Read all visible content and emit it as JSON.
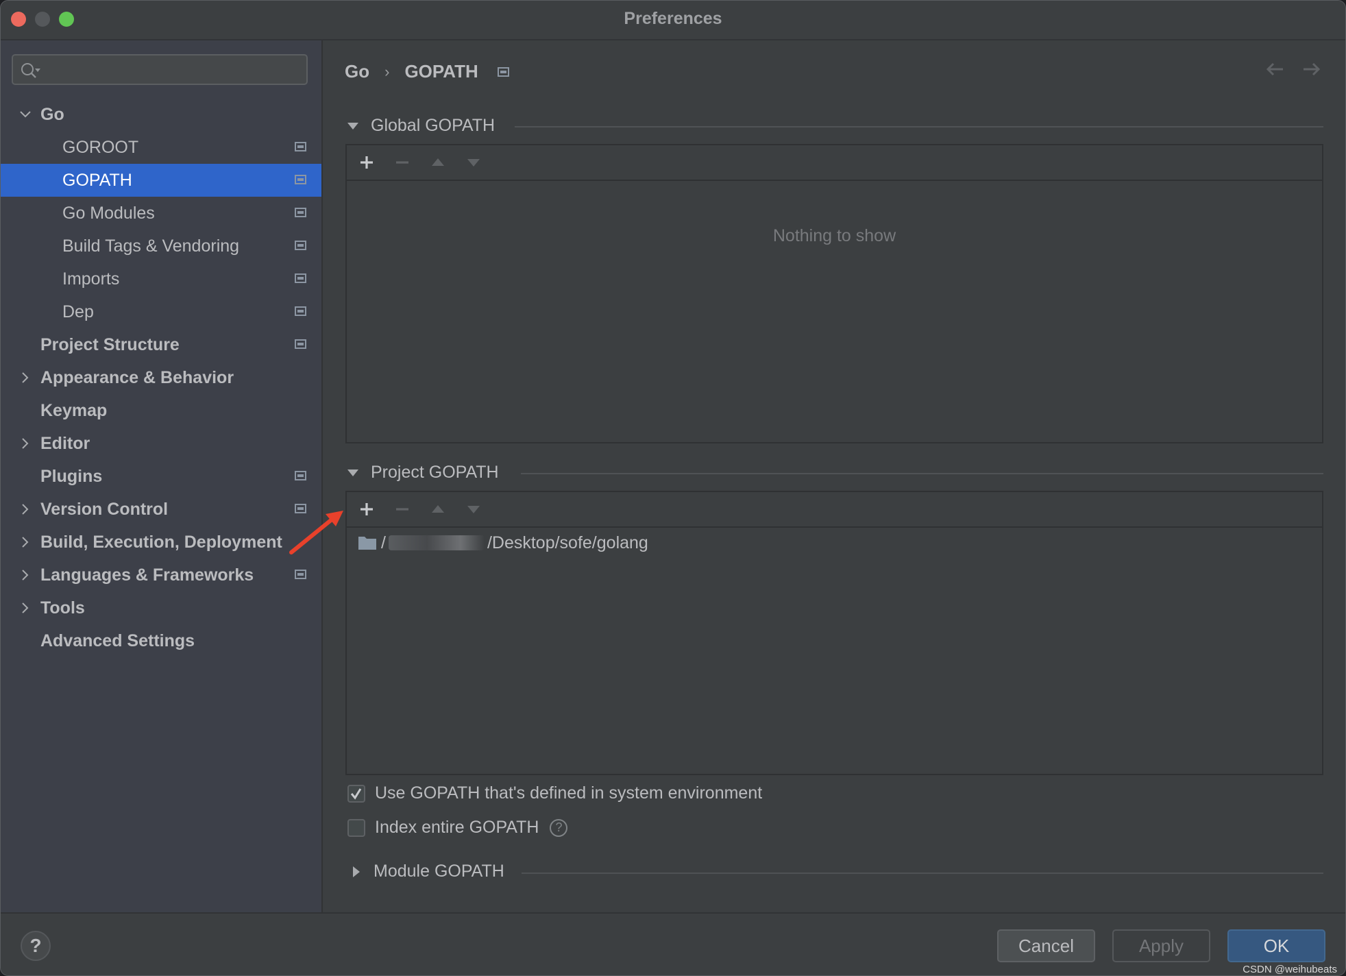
{
  "window": {
    "title": "Preferences",
    "controls": [
      "close",
      "minimize",
      "maximize"
    ]
  },
  "sidebar": {
    "search": {
      "value": "",
      "placeholder": ""
    },
    "items": [
      {
        "label": "Go",
        "level": 0,
        "expandable": true,
        "expanded": true,
        "bold": true,
        "project_icon": false,
        "selected": false
      },
      {
        "label": "GOROOT",
        "level": 1,
        "expandable": false,
        "bold": false,
        "project_icon": true,
        "selected": false
      },
      {
        "label": "GOPATH",
        "level": 1,
        "expandable": false,
        "bold": false,
        "project_icon": true,
        "selected": true
      },
      {
        "label": "Go Modules",
        "level": 1,
        "expandable": false,
        "bold": false,
        "project_icon": true,
        "selected": false
      },
      {
        "label": "Build Tags & Vendoring",
        "level": 1,
        "expandable": false,
        "bold": false,
        "project_icon": true,
        "selected": false
      },
      {
        "label": "Imports",
        "level": 1,
        "expandable": false,
        "bold": false,
        "project_icon": true,
        "selected": false
      },
      {
        "label": "Dep",
        "level": 1,
        "expandable": false,
        "bold": false,
        "project_icon": true,
        "selected": false
      },
      {
        "label": "Project Structure",
        "level": 0,
        "expandable": false,
        "bold": true,
        "project_icon": true,
        "selected": false
      },
      {
        "label": "Appearance & Behavior",
        "level": 0,
        "expandable": true,
        "expanded": false,
        "bold": true,
        "project_icon": false,
        "selected": false
      },
      {
        "label": "Keymap",
        "level": 0,
        "expandable": false,
        "bold": true,
        "project_icon": false,
        "selected": false
      },
      {
        "label": "Editor",
        "level": 0,
        "expandable": true,
        "expanded": false,
        "bold": true,
        "project_icon": false,
        "selected": false
      },
      {
        "label": "Plugins",
        "level": 0,
        "expandable": false,
        "bold": true,
        "project_icon": true,
        "selected": false
      },
      {
        "label": "Version Control",
        "level": 0,
        "expandable": true,
        "expanded": false,
        "bold": true,
        "project_icon": true,
        "selected": false
      },
      {
        "label": "Build, Execution, Deployment",
        "level": 0,
        "expandable": true,
        "expanded": false,
        "bold": true,
        "project_icon": false,
        "selected": false
      },
      {
        "label": "Languages & Frameworks",
        "level": 0,
        "expandable": true,
        "expanded": false,
        "bold": true,
        "project_icon": true,
        "selected": false
      },
      {
        "label": "Tools",
        "level": 0,
        "expandable": true,
        "expanded": false,
        "bold": true,
        "project_icon": false,
        "selected": false
      },
      {
        "label": "Advanced Settings",
        "level": 0,
        "expandable": false,
        "bold": true,
        "project_icon": false,
        "selected": false
      }
    ]
  },
  "main": {
    "breadcrumb": {
      "parent": "Go",
      "separator": "›",
      "current": "GOPATH"
    },
    "nav": {
      "back": "←",
      "forward": "→"
    },
    "global_gopath": {
      "title": "Global GOPATH",
      "expanded": true,
      "toolbar": {
        "add": "+",
        "remove": "−",
        "up": "▲",
        "down": "▼"
      },
      "empty_text": "Nothing to show",
      "entries": []
    },
    "project_gopath": {
      "title": "Project GOPATH",
      "expanded": true,
      "toolbar": {
        "add": "+",
        "remove": "−",
        "up": "▲",
        "down": "▼"
      },
      "entries": [
        {
          "prefix": "/",
          "suffix": "/Desktop/sofe/golang",
          "redacted": true
        }
      ]
    },
    "use_system_gopath": {
      "label": "Use GOPATH that's defined in system environment",
      "checked": true
    },
    "index_entire_gopath": {
      "label": "Index entire GOPATH",
      "checked": false,
      "help": "?"
    },
    "module_gopath": {
      "title": "Module GOPATH",
      "expanded": false
    }
  },
  "footer": {
    "help": "?",
    "cancel": "Cancel",
    "apply": "Apply",
    "ok": "OK"
  },
  "watermark": "CSDN @weihubeats",
  "colors": {
    "selection": "#2f65ca",
    "ok_button": "#365880",
    "annotation_arrow": "#e8412b"
  }
}
